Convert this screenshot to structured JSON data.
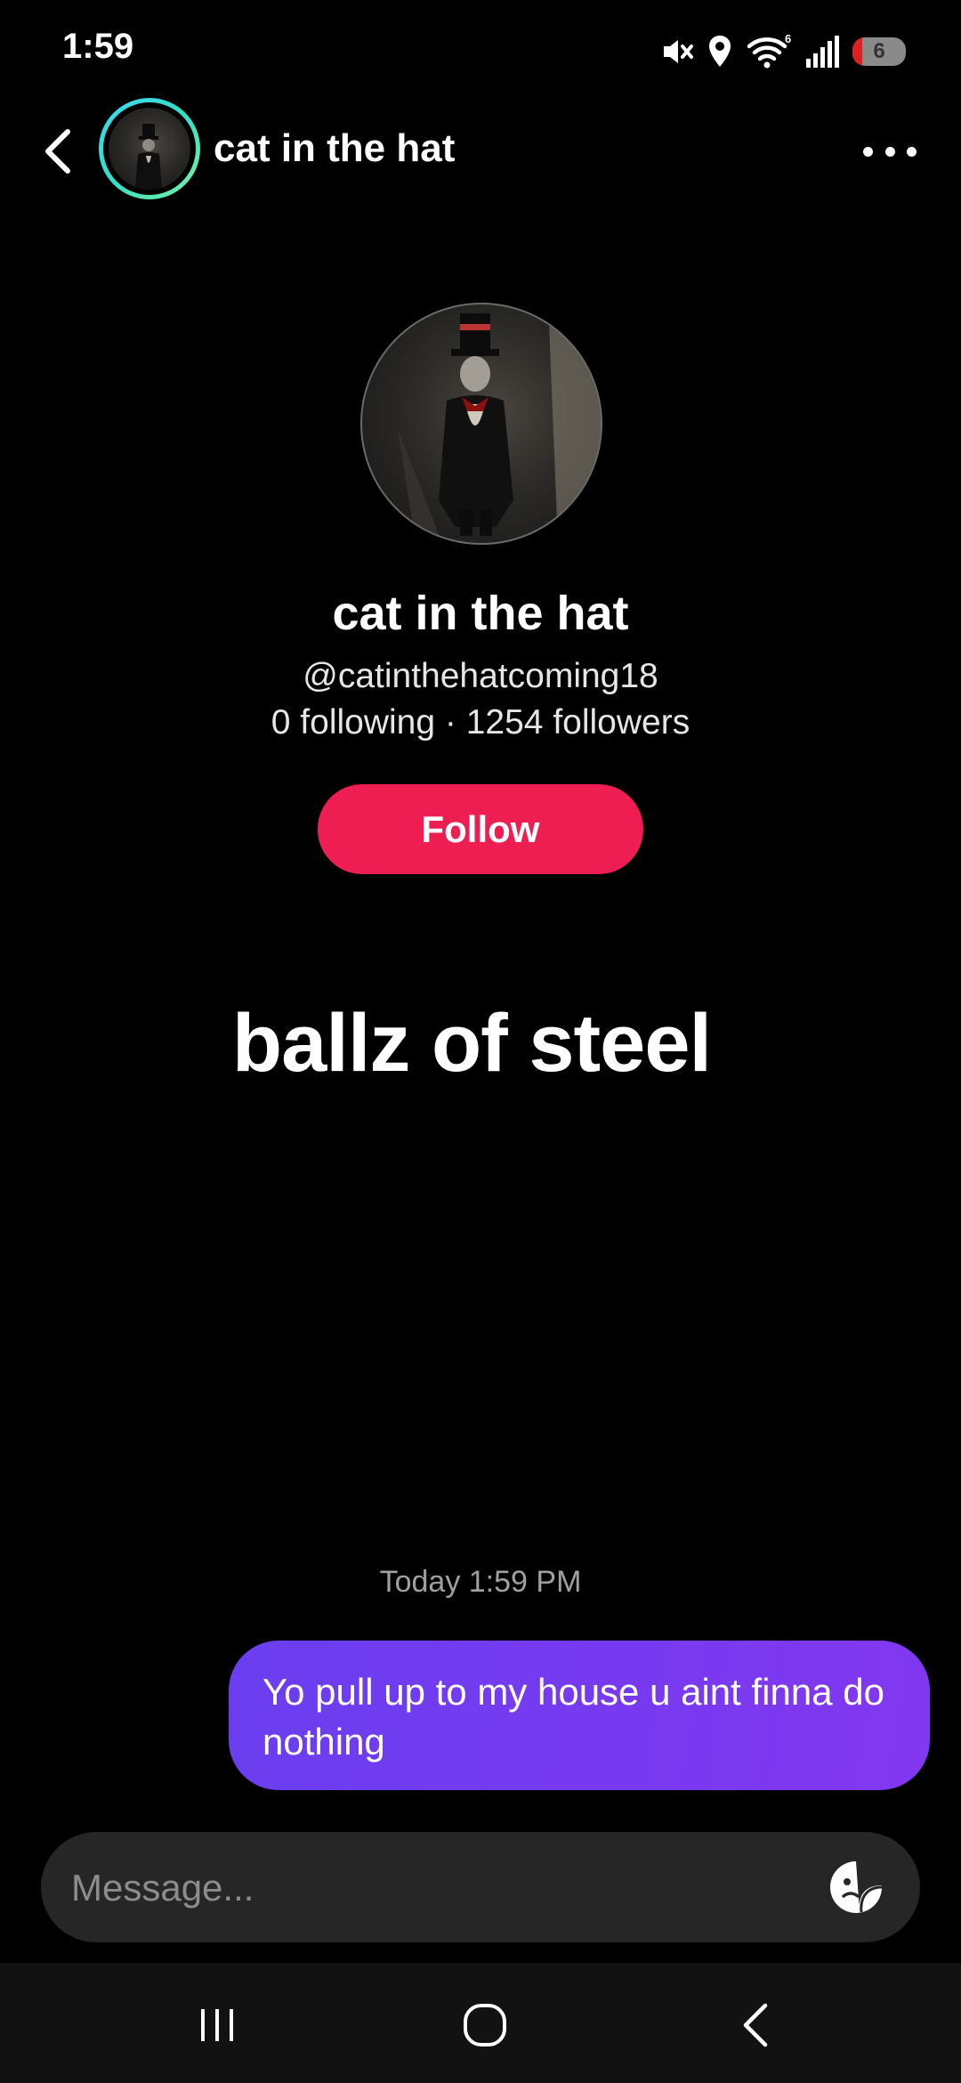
{
  "status_bar": {
    "time": "1:59",
    "battery": "6",
    "battery_level": 0.06,
    "icons": [
      "mute-icon",
      "location-icon",
      "wifi-icon",
      "signal-icon",
      "battery-icon"
    ]
  },
  "header": {
    "name": "cat in the hat",
    "avatar_ring_colors": [
      "#3fd6f2",
      "#30e0c8",
      "#7ef0a0"
    ]
  },
  "profile": {
    "name": "cat in the hat",
    "handle": "@catinthehatcoming18",
    "stats": "0 following · 1254 followers",
    "follow_label": "Follow",
    "bio": "ballz of steel"
  },
  "conversation": {
    "timestamp": "Today 1:59 PM",
    "messages": [
      {
        "from": "me",
        "text": "Yo pull up to my house u aint finna do nothing"
      }
    ]
  },
  "composer": {
    "placeholder": "Message..."
  },
  "colors": {
    "follow": "#ee1d52",
    "bubble_start": "#6a3ef0",
    "bubble_end": "#8237f0",
    "background": "#000000"
  }
}
